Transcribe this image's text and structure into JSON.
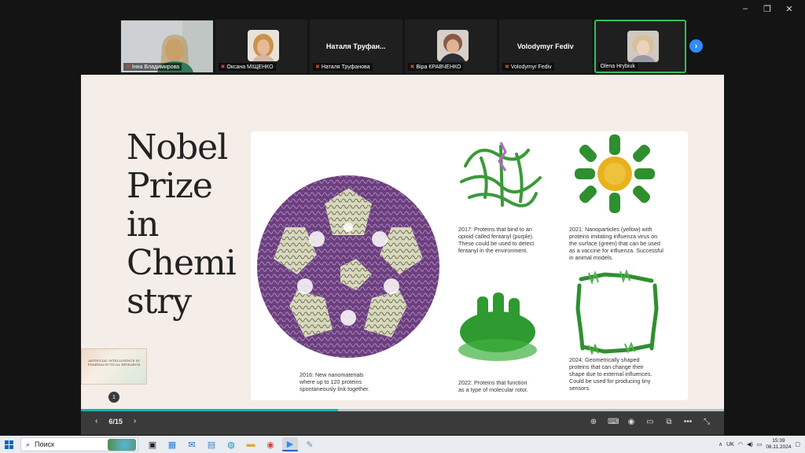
{
  "window": {
    "minimize_glyph": "–",
    "restore_glyph": "❐",
    "close_glyph": "✕"
  },
  "participants": [
    {
      "name": "Інна Владимирова",
      "big_name": "",
      "muted": true,
      "video": true,
      "active": false
    },
    {
      "name": "Оксана МІЩЕНКО",
      "big_name": "",
      "muted": true,
      "video": false,
      "active": false,
      "face_color": "#c9944a"
    },
    {
      "name": "Наталя Труфанова",
      "big_name": "Наталя  Труфан...",
      "muted": true,
      "video": false,
      "active": false
    },
    {
      "name": "Віра КРАВЧЕНКО",
      "big_name": "",
      "muted": true,
      "video": false,
      "active": false,
      "face_color": "#8a5a4a"
    },
    {
      "name": "Volodymyr Fediv",
      "big_name": "Volodymyr Fediv",
      "muted": true,
      "video": false,
      "active": false
    },
    {
      "name": "Olena Hrybiuk",
      "big_name": "",
      "muted": false,
      "video": false,
      "active": true,
      "face_color": "#d7c19a"
    }
  ],
  "next_page_icon": "chevron-right-icon",
  "slide": {
    "title_lines": [
      "Nobel",
      "Prize",
      "in",
      "Chemi",
      "stry"
    ],
    "thumbnail_text": "ARTIFICIAL INTELLIGENCE IN PHARMACEUTICAL RESEARCH",
    "badge": "1",
    "captions": {
      "c2016": "2016: New nanomaterials\nwhere up to 120 proteins\nspontaneously link together.",
      "c2017": "2017: Proteins that bind to an\nopioid called fentanyl (purple).\nThese could be used to detect\nfentanyl in the environment.",
      "c2021": "2021: Nanoparticles (yellow) with\nproteins imitating influenza virus on\nthe surface (green) that can be used\nas a vaccine for influenza. Successful\nin animal models.",
      "c2022": "2022: Proteins that function\nas a type of molecular rotor.",
      "c2024": "2024: Geometrically shaped\nproteins that can change their\nshape due to external influences.\nCould be used for producing tiny\nsensors."
    },
    "progress_fraction": 0.4
  },
  "presenter_bar": {
    "prev_glyph": "‹",
    "next_glyph": "›",
    "page_indicator": "6/15",
    "tools": [
      "⊕",
      "⌨",
      "◉",
      "▭",
      "⧉",
      "•••",
      "⤡"
    ]
  },
  "taskbar": {
    "search_placeholder": "Поиск",
    "keyboard_layout": "UK",
    "time": "15:39",
    "date": "08.11.2024"
  },
  "colors": {
    "accent_green": "#2fbf5a",
    "zoom_blue": "#2d8cff",
    "protein_purple": "#7a4a8c",
    "protein_green": "#3a9a3a",
    "nanoparticle_yellow": "#e8b21f",
    "progress_teal": "#15b3b0"
  }
}
